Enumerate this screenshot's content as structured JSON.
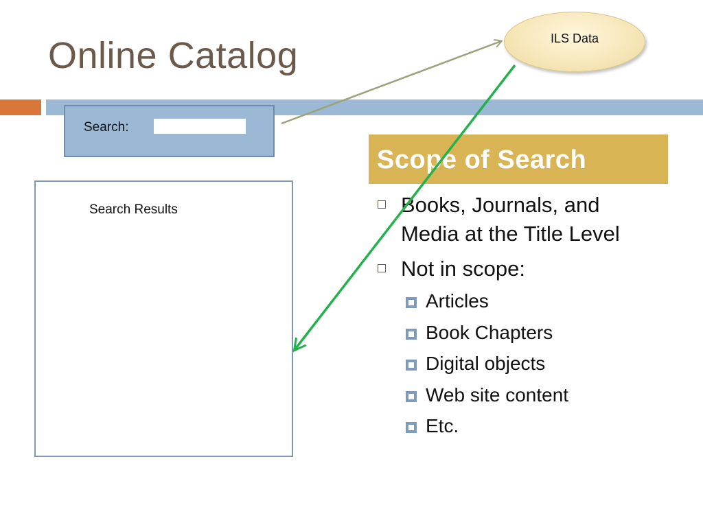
{
  "slide": {
    "title": "Online Catalog"
  },
  "ils": {
    "label": "ILS Data"
  },
  "search": {
    "label": "Search:",
    "value": ""
  },
  "results": {
    "label": "Search Results"
  },
  "scope": {
    "header": "Scope of Search",
    "bullets": [
      {
        "text": "Books, Journals, and",
        "continuation": "Media at the Title Level"
      },
      {
        "text": "Not in scope:",
        "subitems": [
          "Articles",
          "Book Chapters",
          "Digital objects",
          "Web site content",
          "Etc."
        ]
      }
    ]
  },
  "colors": {
    "title_text": "#6b5a4b",
    "accent_orange": "#d9773a",
    "accent_blue": "#9bb8d5",
    "scope_header": "#d9b455",
    "arrow_olive": "#9aa37a",
    "arrow_green": "#22b14c"
  }
}
